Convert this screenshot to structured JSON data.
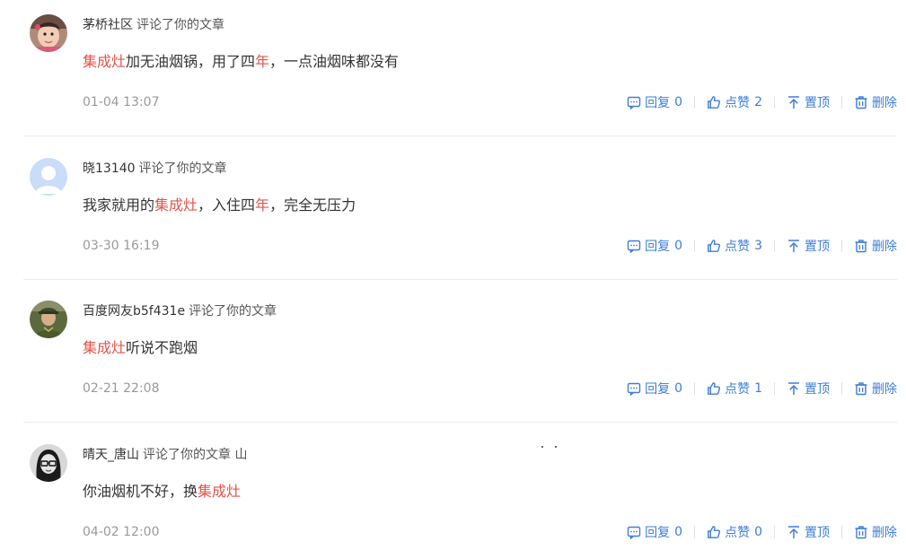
{
  "comments": [
    {
      "author": "茅桥社区",
      "action": "评论了你的文章",
      "text": [
        {
          "t": "集成灶",
          "hl": true
        },
        {
          "t": "加无油烟锅，用了四",
          "hl": false
        },
        {
          "t": "年",
          "hl": true
        },
        {
          "t": "，一点油烟味都没有",
          "hl": false
        }
      ],
      "time": "01-04 13:07",
      "reply_label": "回复",
      "reply_count": "0",
      "like_label": "点赞",
      "like_count": "2",
      "pin_label": "置顶",
      "delete_label": "删除",
      "avatar": "child-photo"
    },
    {
      "author": "晓13140",
      "action": "评论了你的文章",
      "text": [
        {
          "t": "我家就用的",
          "hl": false
        },
        {
          "t": "集成灶",
          "hl": true
        },
        {
          "t": "，入住四",
          "hl": false
        },
        {
          "t": "年",
          "hl": true
        },
        {
          "t": "，完全无压力",
          "hl": false
        }
      ],
      "time": "03-30 16:19",
      "reply_label": "回复",
      "reply_count": "0",
      "like_label": "点赞",
      "like_count": "3",
      "pin_label": "置顶",
      "delete_label": "删除",
      "avatar": "default-user"
    },
    {
      "author": "百度网友b5f431e",
      "action": "评论了你的文章",
      "text": [
        {
          "t": "集成灶",
          "hl": true
        },
        {
          "t": "听说不跑烟",
          "hl": false
        }
      ],
      "time": "02-21 22:08",
      "reply_label": "回复",
      "reply_count": "0",
      "like_label": "点赞",
      "like_count": "1",
      "pin_label": "置顶",
      "delete_label": "删除",
      "avatar": "soldier-photo"
    },
    {
      "author": "晴天_唐山",
      "action": "评论了你的文章 山",
      "text": [
        {
          "t": "你油烟机不好，换",
          "hl": false
        },
        {
          "t": "集成灶",
          "hl": true
        }
      ],
      "time": "04-02 12:00",
      "reply_label": "回复",
      "reply_count": "0",
      "like_label": "点赞",
      "like_count": "0",
      "pin_label": "置顶",
      "delete_label": "删除",
      "avatar": "glasses-bw-photo"
    }
  ],
  "colors": {
    "accent": "#3e7ed6",
    "highlight": "#e1554b",
    "meta": "#999999",
    "divider": "#ececec"
  },
  "icons": {
    "reply": "comment-box-icon",
    "like": "thumbs-up-icon",
    "pin": "pin-top-icon",
    "delete": "trash-icon"
  }
}
